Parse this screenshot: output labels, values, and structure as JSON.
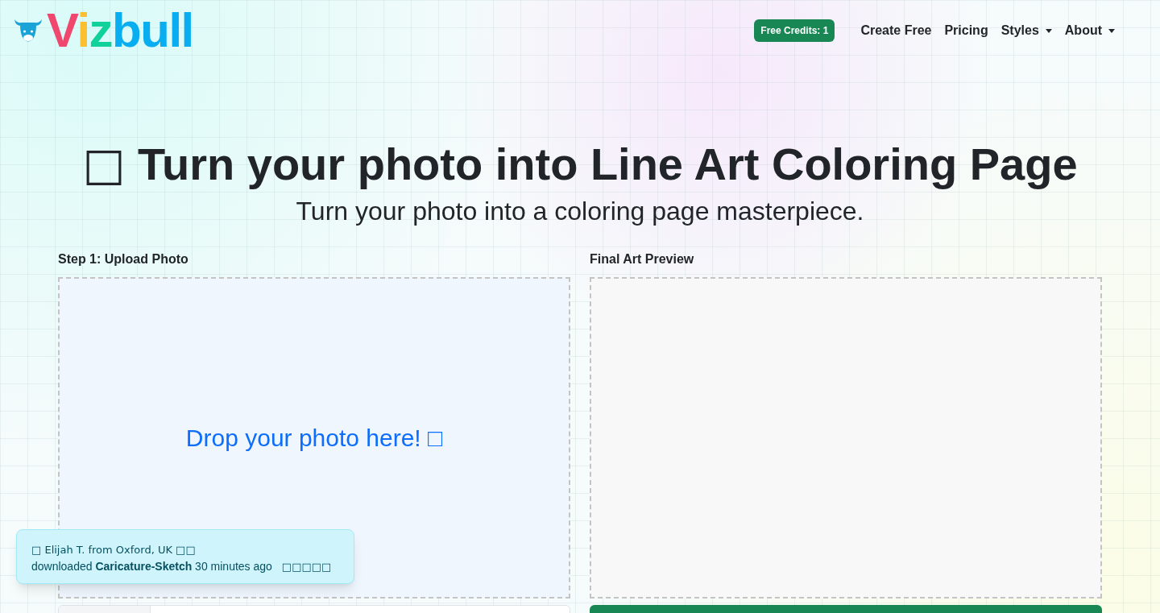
{
  "logo": {
    "text": "Vizbull"
  },
  "nav": {
    "credits_badge": "Free Credits: 1",
    "items": [
      {
        "label": "Create Free",
        "kind": "link"
      },
      {
        "label": "Pricing",
        "kind": "link"
      },
      {
        "label": "Styles",
        "kind": "dropdown"
      },
      {
        "label": "About",
        "kind": "dropdown"
      }
    ]
  },
  "hero": {
    "icon": "□",
    "title": "Turn your photo into Line Art Coloring Page",
    "subtitle": "Turn your photo into a coloring page masterpiece."
  },
  "upload": {
    "label": "Step 1: Upload Photo",
    "prompt": "Drop your photo here! □"
  },
  "preview": {
    "label": "Final Art Preview"
  },
  "toast": {
    "line1": "□ Elijah T. from Oxford, UK □□",
    "line2": "downloaded **Caricature-Sketch** 30 minutes ago",
    "rating": "□□□□□"
  }
}
